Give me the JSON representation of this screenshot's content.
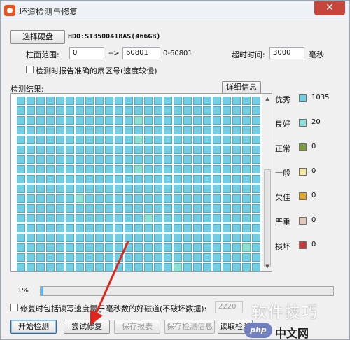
{
  "window": {
    "title": "坏道检测与修复",
    "close_glyph": "✕"
  },
  "disk": {
    "select_button": "选择硬盘",
    "disk_info": "HD0:ST3500418AS(466GB)"
  },
  "range": {
    "label": "柱面范围:",
    "from": "0",
    "arrow": "-->",
    "to": "60801",
    "max": "0-60801"
  },
  "timeout": {
    "label": "超时时间:",
    "value": "3000",
    "unit": "毫秒"
  },
  "options": {
    "report_accurate_label": "检测时报告准确的扇区号(速度较慢)",
    "repair_option_label": "修复时包括读写速度慢于",
    "repair_option_suffix": "毫秒数的好磁道(不破坏数据):",
    "repair_threshold": "2220"
  },
  "results": {
    "label": "检测结果:",
    "details_button": "详细信息",
    "good_cells": [
      62,
      112,
      187,
      256,
      313,
      398,
      441,
      503
    ]
  },
  "legend": [
    {
      "label": "优秀",
      "color": "#72cfe3",
      "count": "1035"
    },
    {
      "label": "良好",
      "color": "#8fe0d4",
      "count": "20"
    },
    {
      "label": "正常",
      "color": "#7c9a3c",
      "count": "0"
    },
    {
      "label": "一般",
      "color": "#f5e9a3",
      "count": "0"
    },
    {
      "label": "欠佳",
      "color": "#e0a431",
      "count": "0"
    },
    {
      "label": "严重",
      "color": "#e3c9bd",
      "count": "0"
    },
    {
      "label": "损坏",
      "color": "#c23a3a",
      "count": "0"
    }
  ],
  "progress": {
    "percent_label": "1%",
    "value": 0.01
  },
  "buttons": {
    "start": "开始检测",
    "repair": "尝试修复",
    "save_report": "保存报表",
    "save_info": "保存检测信息",
    "load": "读取检测"
  },
  "watermark": {
    "text": "软件技巧",
    "site_badge": "php",
    "site_text": "中文网"
  },
  "colors": {
    "accent": "#2b6ea8",
    "arrow": "#e0251c"
  }
}
